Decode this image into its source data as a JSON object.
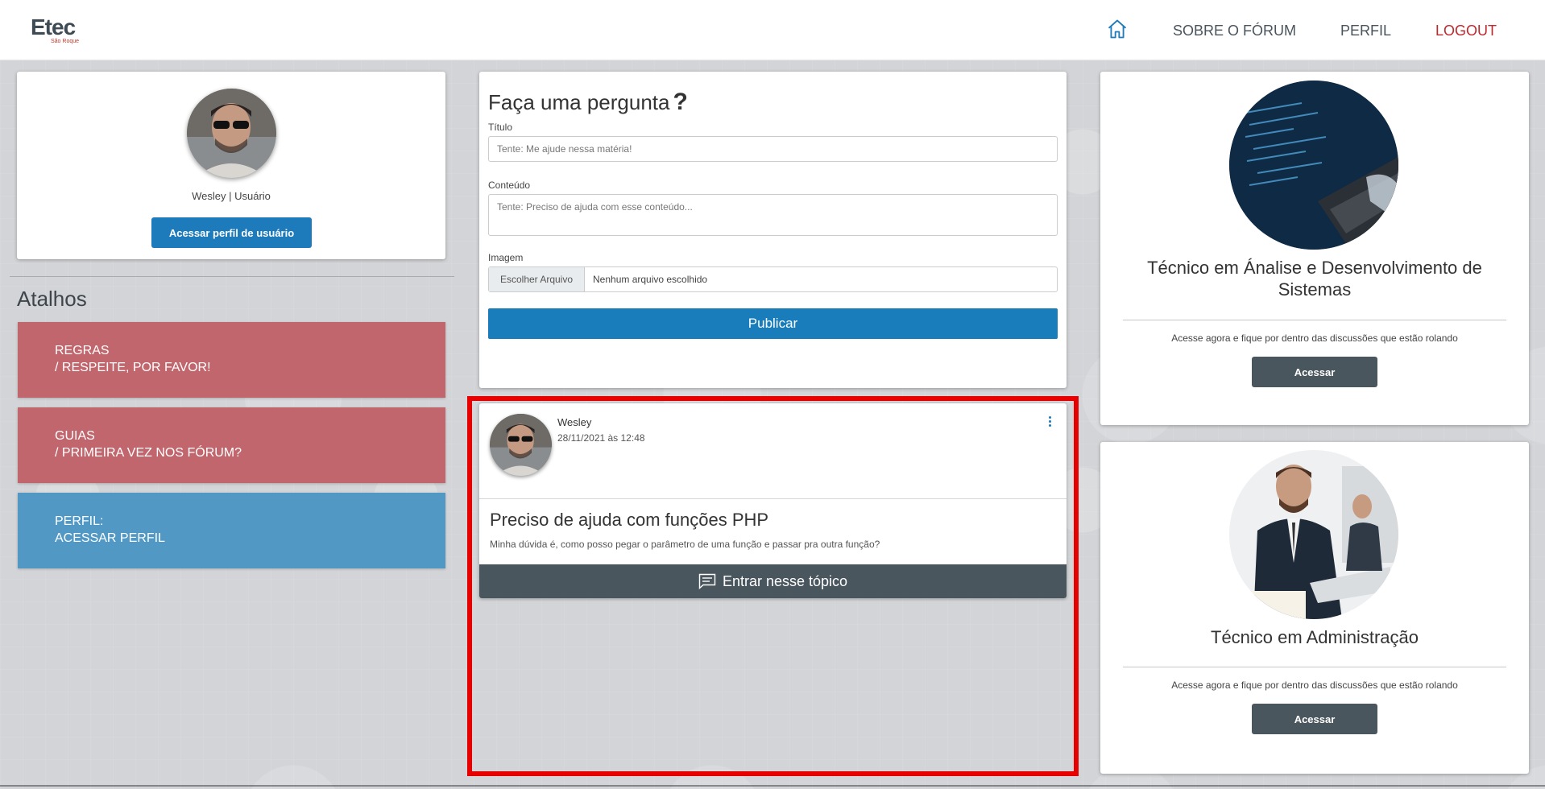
{
  "header": {
    "logo_main": "Etec",
    "logo_sub": "São Roque",
    "nav": {
      "sobre": "SOBRE O FÓRUM",
      "perfil": "PERFIL",
      "logout": "LOGOUT"
    },
    "colors": {
      "accent": "#1e7bbb",
      "logout": "#c0282d"
    }
  },
  "profile": {
    "name_role": "Wesley | Usuário",
    "button": "Acessar perfil de usuário"
  },
  "shortcuts": {
    "title": "Atalhos",
    "items": [
      {
        "line1": "REGRAS",
        "line2": "/ RESPEITE, POR FAVOR!",
        "color": "#c2666e"
      },
      {
        "line1": "GUIAS",
        "line2": "/ PRIMEIRA VEZ NOS FÓRUM?",
        "color": "#c2666e"
      },
      {
        "line1": "PERFIL:",
        "line2": "ACESSAR PERFIL",
        "color": "#5198c5"
      }
    ]
  },
  "ask": {
    "title": "Faça uma pergunta",
    "q_mark": "?",
    "title_label": "Título",
    "title_placeholder": "Tente: Me ajude nessa matéria!",
    "content_label": "Conteúdo",
    "content_placeholder": "Tente: Preciso de ajuda com esse conteúdo...",
    "image_label": "Imagem",
    "file_button": "Escolher Arquivo",
    "file_status": "Nenhum arquivo escolhido",
    "publish": "Publicar"
  },
  "post": {
    "author": "Wesley",
    "date": "28/11/2021 às 12:48",
    "title": "Preciso de ajuda com funções PHP",
    "body": "Minha dúvida é, como posso pegar o parâmetro de uma função e passar pra outra função?",
    "enter": "Entrar nesse tópico"
  },
  "courses": [
    {
      "title": "Técnico em Ánalise e Desenvolvimento de Sistemas",
      "desc": "Acesse agora e fique por dentro das discussões que estão rolando",
      "button": "Acessar"
    },
    {
      "title": "Técnico em Administração",
      "desc": "Acesse agora e fique por dentro das discussões que estão rolando",
      "button": "Acessar"
    }
  ]
}
